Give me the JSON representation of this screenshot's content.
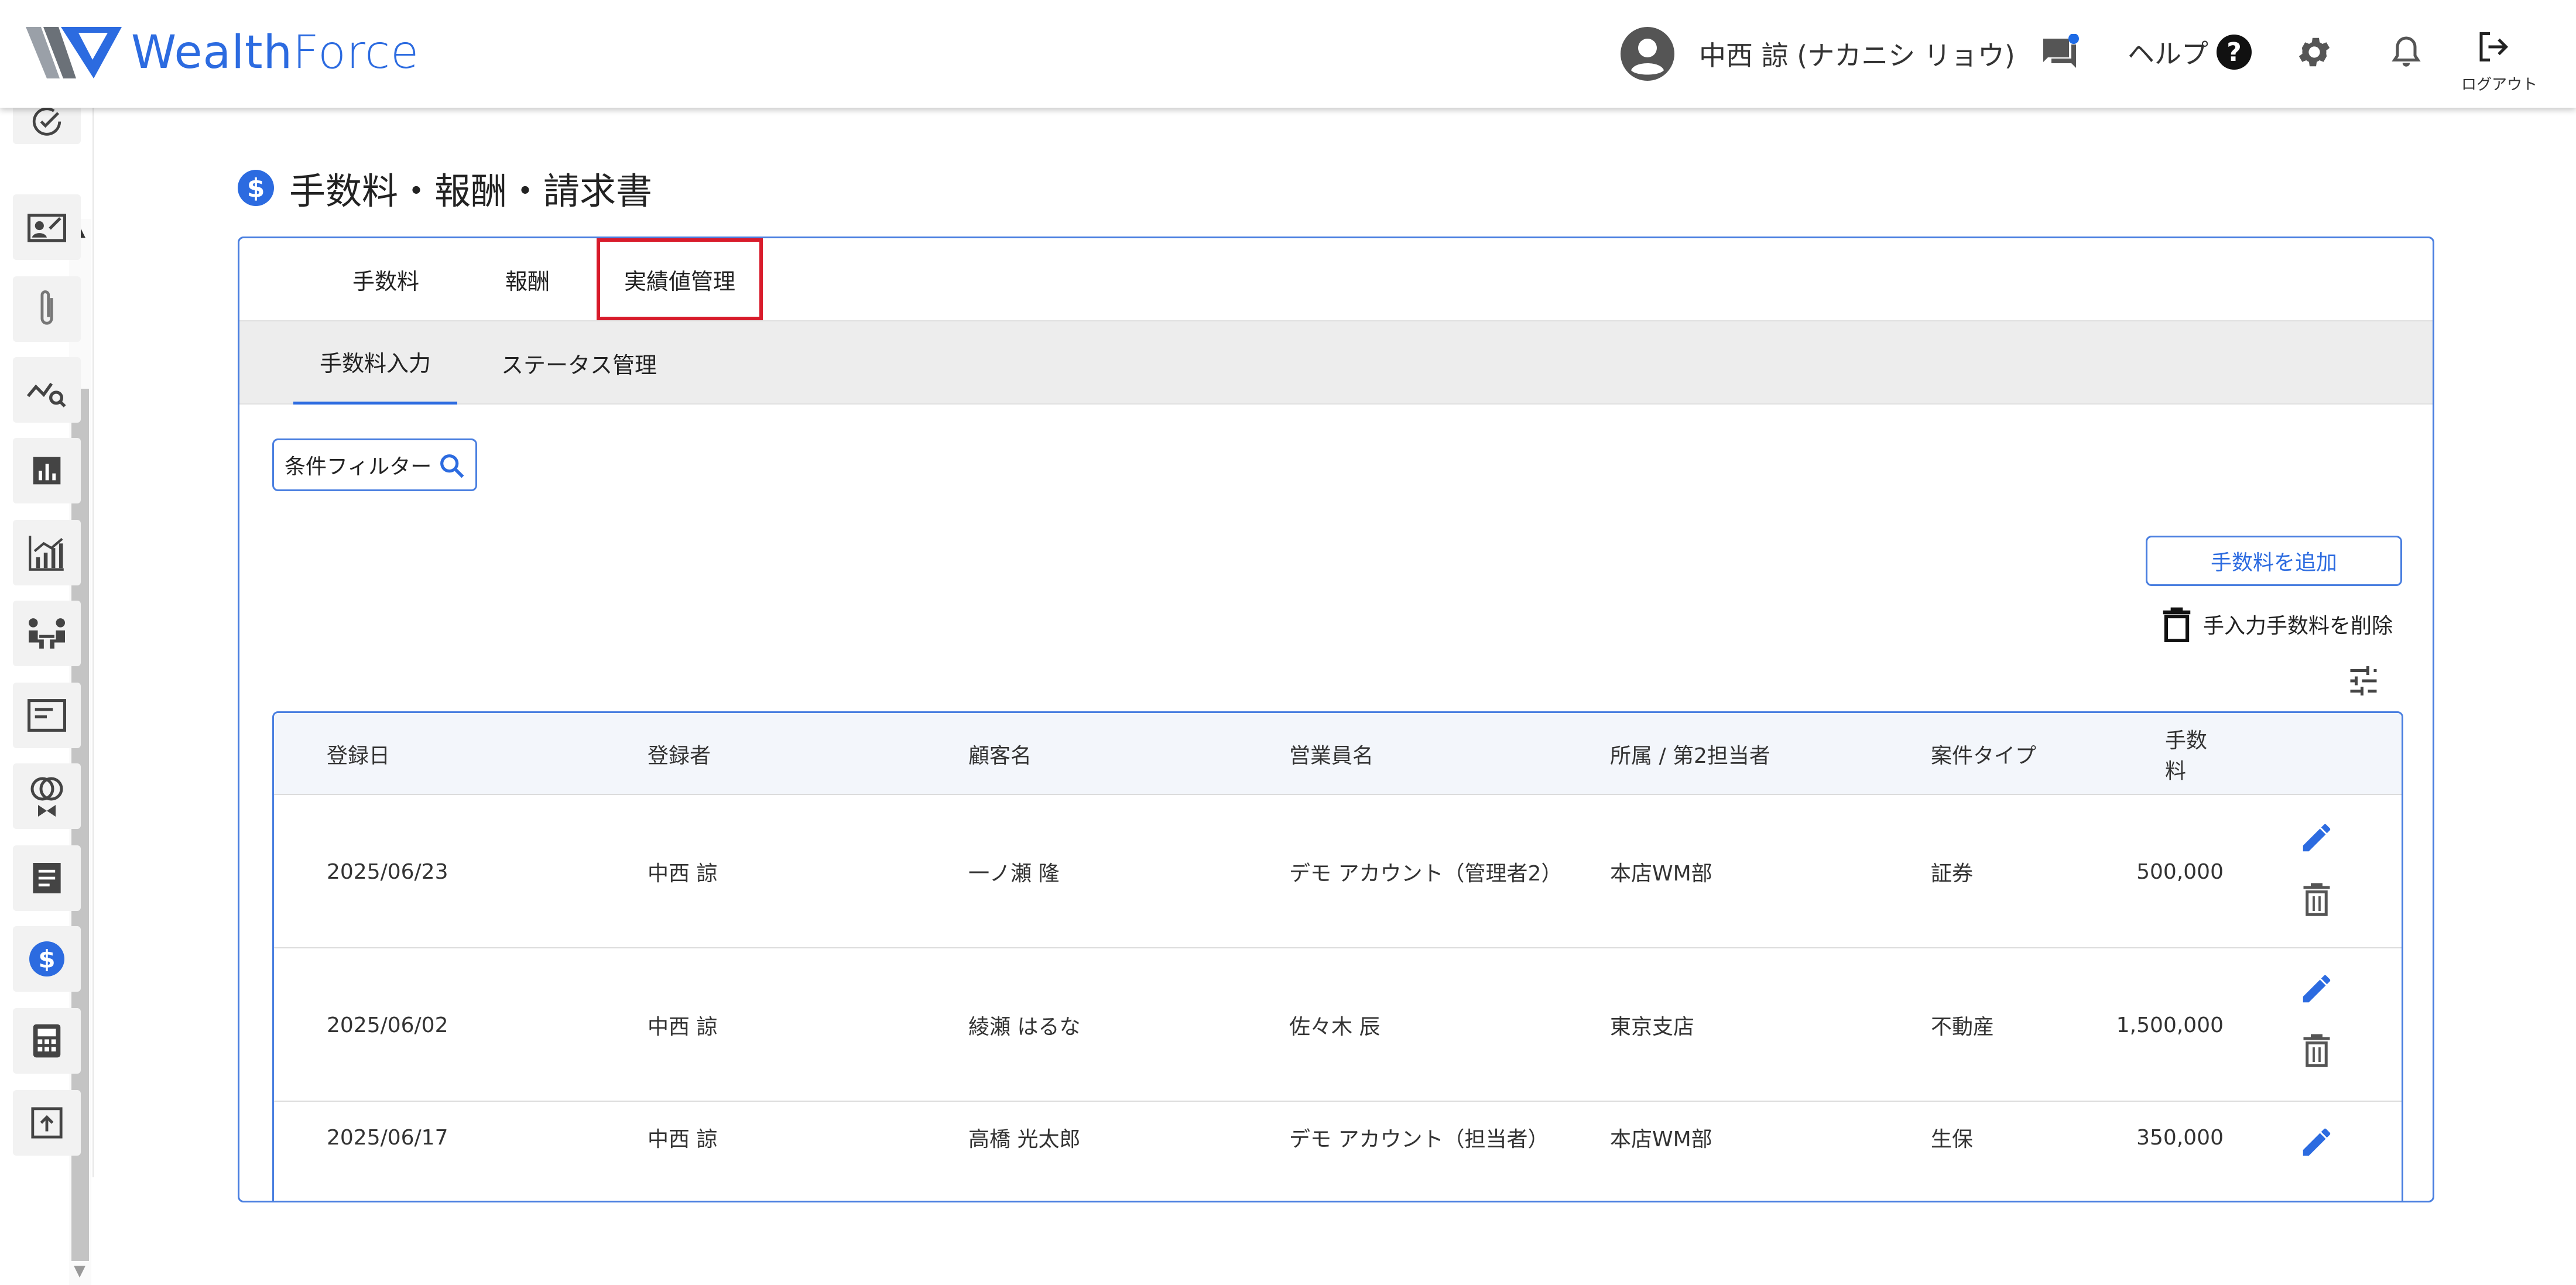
{
  "app": {
    "logo_text_bold": "Wealth",
    "logo_text_light": "Force"
  },
  "header": {
    "user_name": "中西 諒 (ナカニシ リョウ)",
    "help_label": "ヘルプ",
    "help_glyph": "?",
    "logout_label": "ログアウト",
    "icons": [
      "avatar-icon",
      "chat-icon",
      "help-icon",
      "gear-icon",
      "bell-icon",
      "logout-icon"
    ],
    "notification_dot_color": "#1e6be6"
  },
  "sidebar": {
    "items": [
      {
        "icon": "check-circle-icon"
      },
      {
        "icon": "contact-card-icon"
      },
      {
        "icon": "paperclip-icon"
      },
      {
        "icon": "chart-search-icon"
      },
      {
        "icon": "bar-chart-icon"
      },
      {
        "icon": "growth-chart-icon"
      },
      {
        "icon": "meeting-icon"
      },
      {
        "icon": "news-icon"
      },
      {
        "icon": "rings-icon"
      },
      {
        "icon": "document-icon"
      },
      {
        "icon": "dollar-icon",
        "active": true
      },
      {
        "icon": "calculator-icon"
      },
      {
        "icon": "upload-icon"
      }
    ]
  },
  "page": {
    "title": "手数料・報酬・請求書",
    "title_icon_glyph": "$"
  },
  "tabs": [
    {
      "label": "手数料"
    },
    {
      "label": "報酬"
    },
    {
      "label": "実績値管理",
      "highlighted": true
    }
  ],
  "subtabs": [
    {
      "label": "手数料入力",
      "active": true
    },
    {
      "label": "ステータス管理"
    }
  ],
  "filter": {
    "label": "条件フィルター"
  },
  "actions": {
    "add_fee": "手数料を追加",
    "delete_manual": "手入力手数料を削除"
  },
  "table": {
    "columns": [
      "登録日",
      "登録者",
      "顧客名",
      "営業員名",
      "所属 / 第2担当者",
      "案件タイプ",
      "手数料"
    ],
    "rows": [
      [
        "2025/06/23",
        "中西 諒",
        "一ノ瀬 隆",
        "デモ アカウント（管理者2）",
        "本店WM部",
        "証券",
        "500,000"
      ],
      [
        "2025/06/02",
        "中西 諒",
        "綾瀬 はるな",
        "佐々木 辰",
        "東京支店",
        "不動産",
        "1,500,000"
      ],
      [
        "2025/06/17",
        "中西 諒",
        "高橋 光太郎",
        "デモ アカウント（担当者）",
        "本店WM部",
        "生保",
        "350,000"
      ]
    ]
  },
  "colors": {
    "accent": "#2c6be0",
    "highlight_border": "#d81b2b",
    "subtab_bg": "#ededed"
  }
}
